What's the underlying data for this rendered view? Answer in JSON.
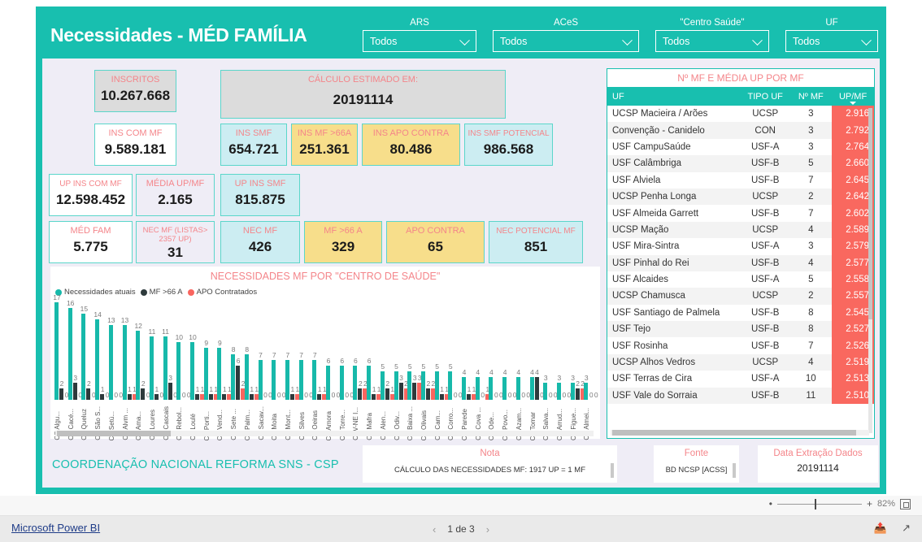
{
  "header": {
    "title": "Necessidades - MÉD FAMÍLIA",
    "slicers": [
      {
        "label": "ARS",
        "value": "Todos"
      },
      {
        "label": "ACeS",
        "value": "Todos"
      },
      {
        "label": "\"Centro Saúde\"",
        "value": "Todos"
      },
      {
        "label": "UF",
        "value": "Todos"
      }
    ]
  },
  "kpis": [
    {
      "label": "INSCRITOS",
      "value": "10.267.668",
      "style": "bg-grey"
    },
    {
      "label": "CÁLCULO ESTIMADO EM:",
      "value": "20191114",
      "style": "bg-grey"
    },
    {
      "label": "INS COM MF",
      "value": "9.589.181",
      "style": "bg-white"
    },
    {
      "label": "INS SMF",
      "value": "654.721",
      "style": "bg-blue"
    },
    {
      "label": "INS MF >66A",
      "value": "251.361",
      "style": "bg-yellow"
    },
    {
      "label": "INS APO CONTRA",
      "value": "80.486",
      "style": "bg-yellow"
    },
    {
      "label": "INS SMF POTENCIAL",
      "value": "986.568",
      "style": "bg-blue"
    },
    {
      "label": "UP INS COM MF",
      "value": "12.598.452",
      "style": "bg-white"
    },
    {
      "label": "MÉDIA UP/MF",
      "value": "2.165",
      "style": "bg-lav"
    },
    {
      "label": "UP INS SMF",
      "value": "815.875",
      "style": "bg-blue"
    },
    {
      "label": "MÉD FAM",
      "value": "5.775",
      "style": "bg-white"
    },
    {
      "label": "NEC MF (LISTAS> 2357 UP)",
      "value": "31",
      "style": "bg-lav"
    },
    {
      "label": "NEC MF",
      "value": "426",
      "style": "bg-blue"
    },
    {
      "label": "MF >66 A",
      "value": "329",
      "style": "bg-yellow"
    },
    {
      "label": "APO CONTRA",
      "value": "65",
      "style": "bg-yellow"
    },
    {
      "label": "NEC POTENCIAL MF",
      "value": "851",
      "style": "bg-blue"
    }
  ],
  "chart_data": {
    "type": "bar",
    "title": "NECESSIDADES MF POR \"CENTRO DE SAÚDE\"",
    "xlabel": "",
    "ylabel": "",
    "ylim": [
      0,
      17
    ],
    "grid": false,
    "legend_position": "top-left",
    "legend": [
      {
        "name": "Necessidades atuais",
        "color": "#17B9AA"
      },
      {
        "name": "MF >66 A",
        "color": "#2E3A3C"
      },
      {
        "name": "APO Contratados",
        "color": "#F9655F"
      }
    ],
    "categories": [
      "CS Algu...",
      "CS Cacé...",
      "CS Queluz",
      "CS São S...",
      "CS Setú...",
      "CS Alvm ...",
      "CS Ama...",
      "CS Loures",
      "CS Cascais",
      "CS Rebol...",
      "CS Loulé",
      "CS Porti...",
      "CS Vend...",
      "CS Sete ...",
      "CS Palm...",
      "CS Sacav...",
      "CS Moita",
      "CS Mont...",
      "CS Silves",
      "CS Oeiras",
      "CS Amora",
      "CS Torre...",
      "CSV-NE I...",
      "CS Mafra",
      "CS Alen...",
      "CS Odiv...",
      "CS Baixa ...",
      "CS Olivais",
      "CS Cam...",
      "CS Corro...",
      "CS Parede",
      "CS Cova ...",
      "CS Ode...",
      "CS Povo...",
      "CS Azam...",
      "CS Tomar",
      "CS Salva...",
      "CS Arrud...",
      "CS Figue...",
      "CS Almei..."
    ],
    "series": [
      {
        "name": "Necessidades atuais",
        "color": "#17B9AA",
        "values": [
          17,
          16,
          15,
          14,
          13,
          13,
          12,
          11,
          11,
          10,
          10,
          9,
          9,
          8,
          8,
          7,
          7,
          7,
          7,
          7,
          6,
          6,
          6,
          6,
          5,
          5,
          5,
          5,
          5,
          5,
          4,
          4,
          4,
          4,
          4,
          4,
          3,
          3,
          3,
          3
        ]
      },
      {
        "name": "MF >66 A",
        "color": "#2E3A3C",
        "values": [
          2,
          3,
          2,
          1,
          0,
          1,
          2,
          1,
          3,
          0,
          1,
          1,
          1,
          6,
          1,
          0,
          0,
          1,
          0,
          1,
          0,
          0,
          2,
          1,
          2,
          3,
          3,
          2,
          1,
          0,
          1,
          0,
          0,
          0,
          0,
          4,
          0,
          0,
          2,
          0
        ]
      },
      {
        "name": "APO Contratados",
        "color": "#F9655F",
        "values": [
          0,
          0,
          0,
          0,
          0,
          1,
          0,
          0,
          0,
          0,
          1,
          1,
          1,
          2,
          1,
          0,
          0,
          1,
          0,
          1,
          0,
          0,
          2,
          1,
          1,
          2,
          3,
          2,
          1,
          0,
          1,
          1,
          0,
          0,
          0,
          0,
          0,
          0,
          2,
          0
        ]
      }
    ]
  },
  "table": {
    "title": "Nº MF E MÉDIA UP POR MF",
    "columns": [
      "UF",
      "TIPO UF",
      "Nº MF",
      "UP/MF"
    ],
    "sorted_column": "UP/MF",
    "rows": [
      {
        "uf": "UCSP Macieira / Arões",
        "tipo": "UCSP",
        "nmf": "3",
        "upmf": "2.916"
      },
      {
        "uf": "Convenção - Canidelo",
        "tipo": "CON",
        "nmf": "3",
        "upmf": "2.792"
      },
      {
        "uf": "USF CampuSaúde",
        "tipo": "USF-A",
        "nmf": "3",
        "upmf": "2.764"
      },
      {
        "uf": "USF Calâmbriga",
        "tipo": "USF-B",
        "nmf": "5",
        "upmf": "2.660"
      },
      {
        "uf": "USF Alviela",
        "tipo": "USF-B",
        "nmf": "7",
        "upmf": "2.645"
      },
      {
        "uf": "UCSP Penha Longa",
        "tipo": "UCSP",
        "nmf": "2",
        "upmf": "2.642"
      },
      {
        "uf": "USF Almeida Garrett",
        "tipo": "USF-B",
        "nmf": "7",
        "upmf": "2.602"
      },
      {
        "uf": "UCSP Mação",
        "tipo": "UCSP",
        "nmf": "4",
        "upmf": "2.589"
      },
      {
        "uf": "USF Mira-Sintra",
        "tipo": "USF-A",
        "nmf": "3",
        "upmf": "2.579"
      },
      {
        "uf": "USF Pinhal do Rei",
        "tipo": "USF-B",
        "nmf": "4",
        "upmf": "2.577"
      },
      {
        "uf": "USF Alcaides",
        "tipo": "USF-A",
        "nmf": "5",
        "upmf": "2.558"
      },
      {
        "uf": "UCSP Chamusca",
        "tipo": "UCSP",
        "nmf": "2",
        "upmf": "2.557"
      },
      {
        "uf": "USF Santiago de Palmela",
        "tipo": "USF-B",
        "nmf": "8",
        "upmf": "2.545"
      },
      {
        "uf": "USF Tejo",
        "tipo": "USF-B",
        "nmf": "8",
        "upmf": "2.527"
      },
      {
        "uf": "USF Rosinha",
        "tipo": "USF-B",
        "nmf": "7",
        "upmf": "2.526"
      },
      {
        "uf": "UCSP Alhos Vedros",
        "tipo": "UCSP",
        "nmf": "4",
        "upmf": "2.519"
      },
      {
        "uf": "USF Terras de Cira",
        "tipo": "USF-A",
        "nmf": "10",
        "upmf": "2.513"
      },
      {
        "uf": "USF Vale do Sorraia",
        "tipo": "USF-B",
        "nmf": "11",
        "upmf": "2.510"
      }
    ]
  },
  "footer": {
    "org": "COORDENAÇÃO NACIONAL REFORMA SNS - CSP",
    "note_title": "Nota",
    "note_body": "CÁLCULO DAS NECESSIDADES MF: 1917 UP = 1 MF",
    "source_title": "Fonte",
    "source_body": "BD NCSP [ACSS]",
    "date_title": "Data Extração Dados",
    "date_body": "20191114"
  },
  "chrome": {
    "zoom_level": "82%",
    "brand": "Microsoft Power BI",
    "page_indicator": "1 de 3",
    "prev_arrow": "‹",
    "next_arrow": "›",
    "minus": "•",
    "plus": "+"
  }
}
